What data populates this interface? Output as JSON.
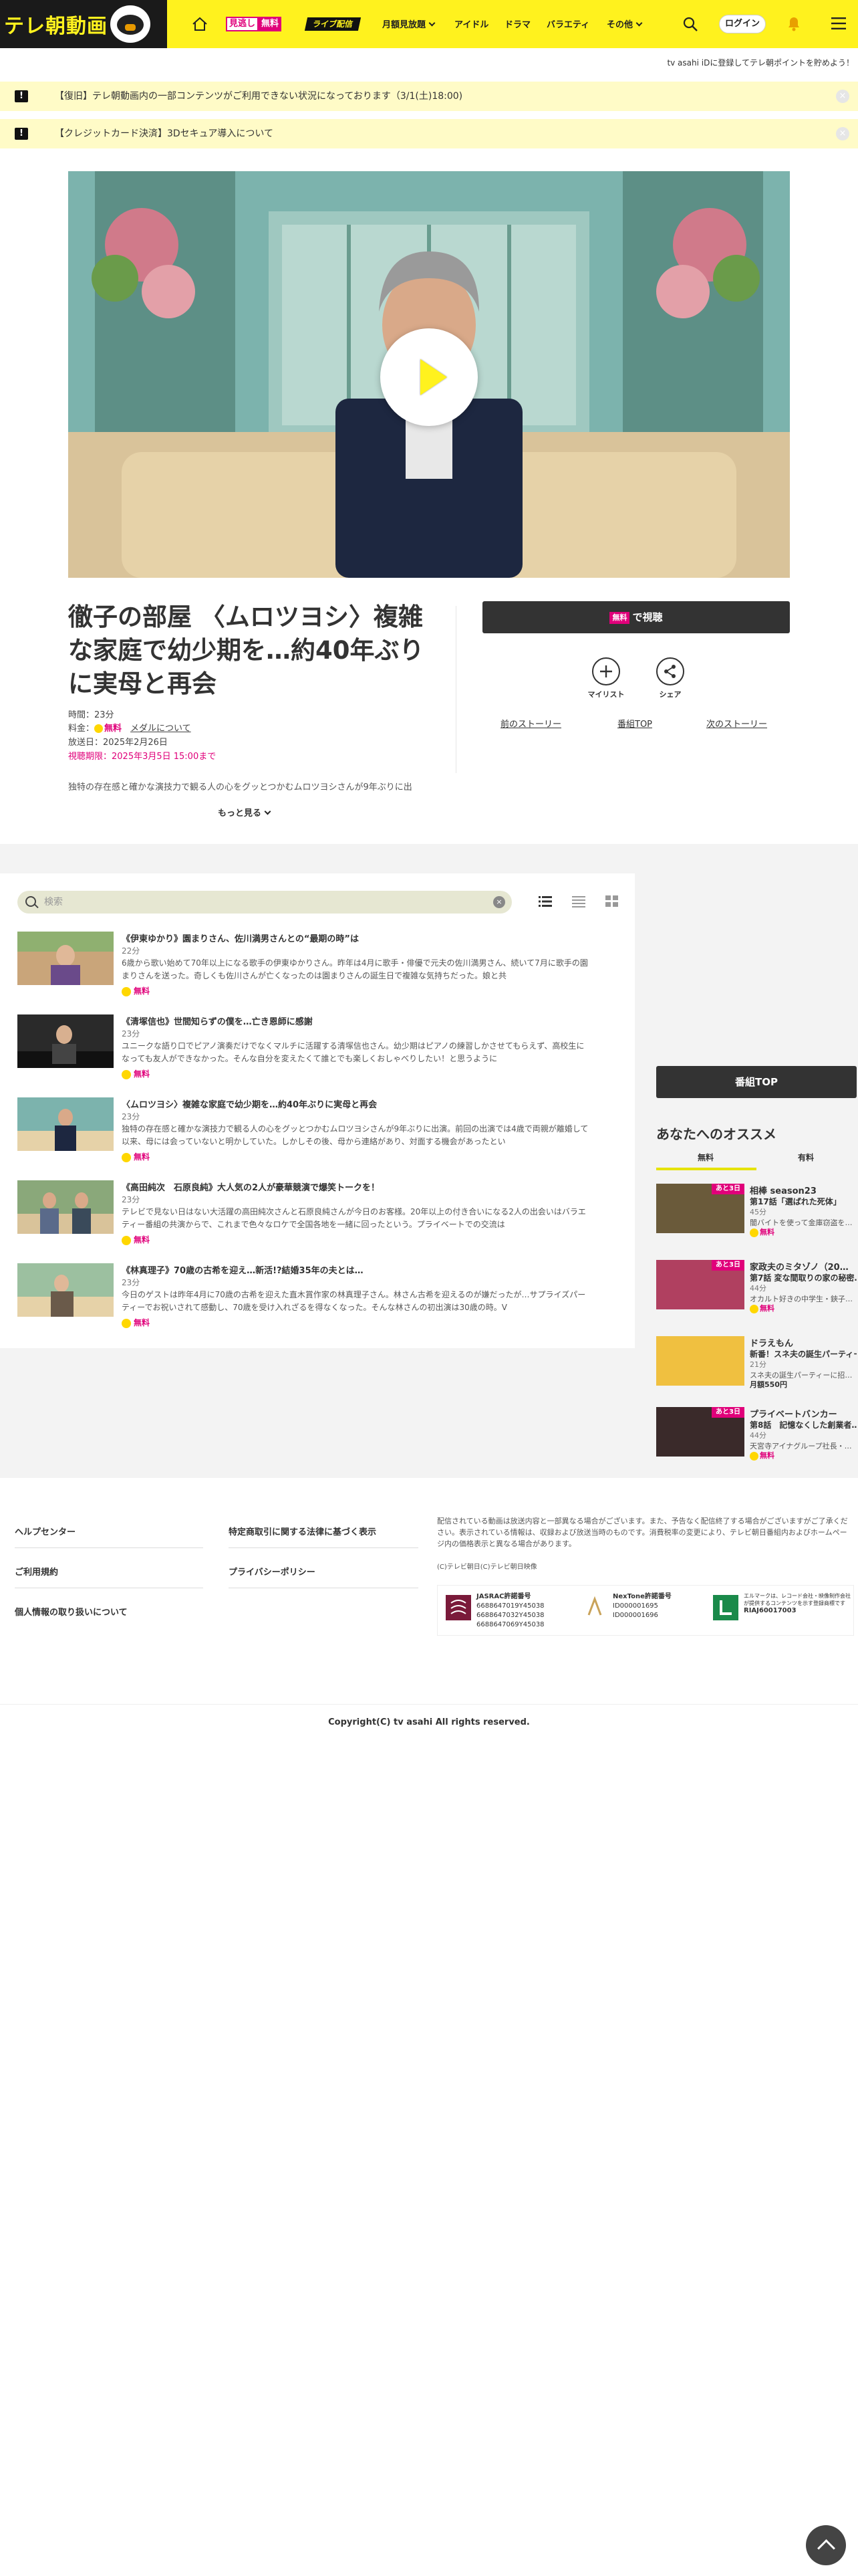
{
  "header": {
    "logo": "テレ朝動画",
    "mitai_badge_a": "見逃し",
    "mitai_badge_b": "無料",
    "live_badge": "ライブ配信",
    "nav": [
      "月額見放題",
      "アイドル",
      "ドラマ",
      "バラエティ",
      "その他"
    ],
    "login": "ログイン"
  },
  "substrip": "tv asahi iDに登録してテレ朝ポイントを貯めよう！",
  "notices": [
    "【復旧】テレ朝動画内の一部コンテンツがご利用できない状況になっております（3/1(土)18:00)",
    "【クレジットカード決済】3Dセキュア導入について"
  ],
  "episode": {
    "title": "徹子の部屋 〈ムロツヨシ〉複雑な家庭で幼少期を…約40年ぶりに実母と再会",
    "time": "時間：23分",
    "price_label": "料金：",
    "price_free": "無料",
    "member_link": "メダルについて",
    "aired": "放送日：2025年2月26日",
    "deadline": "視聴期限：2025年3月5日 15:00まで",
    "description": "独特の存在感と確かな演技力で観る人の心をグッとつかむムロツヨシさんが9年ぶりに出",
    "more": "もっと見る",
    "watch_free": "無料",
    "watch_label": "で視聴",
    "mylist": "マイリスト",
    "share": "シェア",
    "prev": "前のストーリー",
    "top": "番組TOP",
    "next": "次のストーリー"
  },
  "list": {
    "search_placeholder": "検索",
    "items": [
      {
        "title": "《伊東ゆかり》園まりさん、佐川満男さんとの“最期の時”は",
        "dur": "22分",
        "desc": "6歳から歌い始めて70年以上になる歌手の伊東ゆかりさん。昨年は4月に歌手・俳優で元夫の佐川満男さん、続いて7月に歌手の園まりさんを送った。奇しくも佐川さんが亡くなったのは園まりさんの誕生日で複雑な気持ちだった。娘と共",
        "free": "無料"
      },
      {
        "title": "《清塚信也》世間知らずの僕を…亡き恩師に感謝",
        "dur": "23分",
        "desc": "ユニークな語り口でピアノ演奏だけでなくマルチに活躍する清塚信也さん。幼少期はピアノの練習しかさせてもらえず、高校生になっても友人ができなかった。そんな自分を変えたくて誰とでも楽しくおしゃべりしたい！と思うように",
        "free": "無料"
      },
      {
        "title": "〈ムロツヨシ〉複雑な家庭で幼少期を…約40年ぶりに実母と再会",
        "dur": "23分",
        "desc": "独特の存在感と確かな演技力で観る人の心をグッとつかむムロツヨシさんが9年ぶりに出演。前回の出演では4歳で両親が離婚して以来、母には会っていないと明かしていた。しかしその後、母から連絡があり、対面する機会があったとい",
        "free": "無料"
      },
      {
        "title": "《高田純次　石原良純》大人気の2人が豪華競演で爆笑トークを！",
        "dur": "23分",
        "desc": "テレビで見ない日はない大活躍の高田純次さんと石原良純さんが今日のお客様。20年以上の付き合いになる2人の出会いはバラエティー番組の共演からで、これまで色々なロケで全国各地を一緒に回ったという。プライベートでの交流は",
        "free": "無料"
      },
      {
        "title": "《林真理子》70歳の古希を迎え…新活!?結婚35年の夫とは…",
        "dur": "23分",
        "desc": "今日のゲストは昨年4月に70歳の古希を迎えた直木賞作家の林真理子さん。林さん古希を迎えるのが嫌だったが…サプライズパーティーでお祝いされて感動し、70歳を受け入れざるを得なくなった。そんな林さんの初出演は30歳の時。V",
        "free": "無料"
      }
    ]
  },
  "sidebar": {
    "program_top": "番組TOP",
    "recommend_title": "あなたへのオススメ",
    "tab_free": "無料",
    "tab_paid": "有料",
    "items": [
      {
        "tag": "あと3日",
        "t1": "相棒 season23",
        "t2": "第17話「選ばれた死体」",
        "dur": "45分",
        "desc": "闇バイトを使って金庫窃盗を…",
        "price": "無料"
      },
      {
        "tag": "あと3日",
        "t1": "家政夫のミタゾノ（20…",
        "t2": "第7話 変な間取りの家の秘密…",
        "dur": "44分",
        "desc": "オカルト好きの中学生・鋏子…",
        "price": "無料"
      },
      {
        "tag": "",
        "t1": "ドラえもん",
        "t2": "新番！スネ夫の誕生パーティー…",
        "dur": "21分",
        "desc": "スネ夫の誕生パーティーに招…",
        "price": "月額550円"
      },
      {
        "tag": "あと3日",
        "t1": "プライベートバンカー",
        "t2": "第8話　記憶なくした創業者…",
        "dur": "44分",
        "desc": "天宮寺アイナグループ社長・…",
        "price": "無料"
      }
    ]
  },
  "footer": {
    "col1": [
      "ヘルプセンター",
      "ご利用規約",
      "個人情報の取り扱いについて"
    ],
    "col2": [
      "特定商取引に関する法律に基づく表示",
      "プライバシーポリシー"
    ],
    "note": "配信されている動画は放送内容と一部異なる場合がございます。また、予告なく配信終了する場合がございますがご了承ください。表示されている情報は、収録および放送当時のものです。消費税率の変更により、テレビ朝日番組内およびホームページ内の価格表示と異なる場合があります。",
    "copy_small": "(C)テレビ朝日(C)テレビ朝日映像",
    "jasrac_title": "JASRAC許諾番号",
    "jasrac_nums": [
      "6688647019Y45038",
      "6688647032Y45038",
      "6688647069Y45038"
    ],
    "nextone_title": "NexTone許諾番号",
    "nextone_nums": [
      "ID000001695",
      "ID000001696"
    ],
    "lmark_text": "エルマークは、レコード会社・映像制作会社が提供するコンテンツを示す登録商標です",
    "lmark_num": "RIAJ60017003",
    "copyright": "Copyright(C) tv asahi All rights reserved."
  }
}
